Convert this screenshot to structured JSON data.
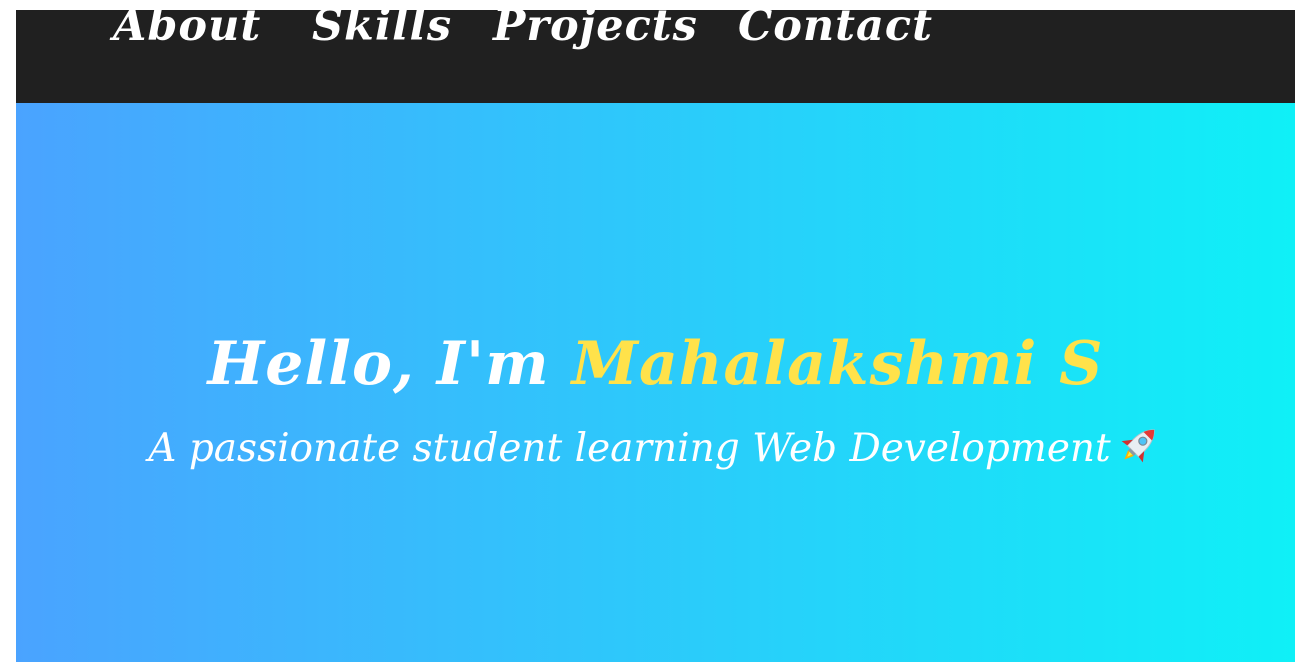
{
  "nav": {
    "items": [
      {
        "label": "About"
      },
      {
        "label": "Skills"
      },
      {
        "label": "Projects"
      },
      {
        "label": "Contact"
      }
    ]
  },
  "hero": {
    "greeting": "Hello, I'm ",
    "name": "Mahalakshmi S",
    "subtitle": "A passionate student learning Web Development",
    "icon": "rocket-icon"
  },
  "colors": {
    "navbar_bg": "#202020",
    "nav_text": "#ffffff",
    "gradient_start": "#4aa3ff",
    "gradient_end": "#0ff0f7",
    "name_highlight": "#ffe24a",
    "hero_text": "#ffffff"
  }
}
